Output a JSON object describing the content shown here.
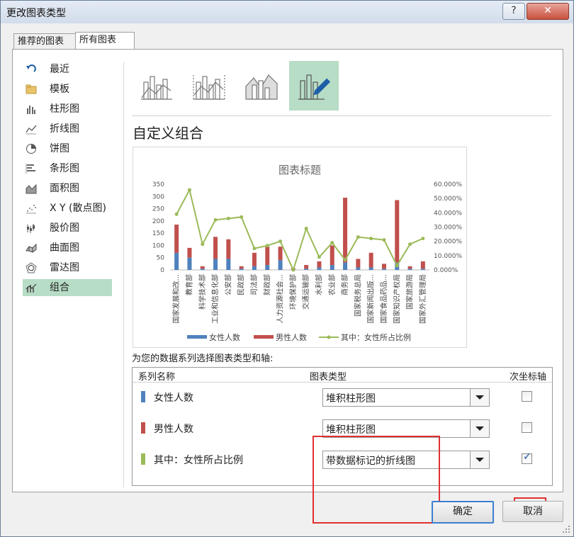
{
  "window": {
    "title": "更改图表类型",
    "help": "?",
    "close": "✕"
  },
  "tabs": [
    {
      "label": "推荐的图表"
    },
    {
      "label": "所有图表"
    }
  ],
  "sidebar": {
    "items": [
      {
        "label": "最近",
        "icon": "undo-icon"
      },
      {
        "label": "模板",
        "icon": "folder-icon"
      },
      {
        "label": "柱形图",
        "icon": "column-chart-icon"
      },
      {
        "label": "折线图",
        "icon": "line-chart-icon"
      },
      {
        "label": "饼图",
        "icon": "pie-chart-icon"
      },
      {
        "label": "条形图",
        "icon": "bar-chart-icon"
      },
      {
        "label": "面积图",
        "icon": "area-chart-icon"
      },
      {
        "label": "X Y (散点图)",
        "icon": "scatter-chart-icon"
      },
      {
        "label": "股价图",
        "icon": "stock-chart-icon"
      },
      {
        "label": "曲面图",
        "icon": "surface-chart-icon"
      },
      {
        "label": "雷达图",
        "icon": "radar-chart-icon"
      },
      {
        "label": "组合",
        "icon": "combo-chart-icon",
        "selected": true
      }
    ]
  },
  "thumbnails": [
    {
      "icon": "clustered-column-line-icon"
    },
    {
      "icon": "clustered-column-line-secondary-icon"
    },
    {
      "icon": "stacked-area-column-icon"
    },
    {
      "icon": "custom-combination-icon",
      "selected": true
    }
  ],
  "heading": "自定义组合",
  "chart_data": {
    "type": "bar",
    "title": "图表标题",
    "categories": [
      "国家发展和改...",
      "教育部",
      "科学技术部",
      "工业和信息化部",
      "公安部",
      "民政部",
      "司法部",
      "财政部",
      "人力资源社会...",
      "环境保护部",
      "交通运输部",
      "水利部",
      "农业部",
      "商务部",
      "国家税务总局",
      "国家新闻出版...",
      "国家食品药品...",
      "国家知识产权局",
      "国家旅游局",
      "国家外汇管理局"
    ],
    "series": [
      {
        "name": "女性人数",
        "chart": "stacked-bar",
        "axis": "primary",
        "color": "#4f81bd",
        "values": [
          70,
          50,
          5,
          45,
          45,
          5,
          15,
          20,
          40,
          2,
          5,
          10,
          20,
          30,
          10,
          10,
          5,
          30,
          5,
          5
        ]
      },
      {
        "name": "男性人数",
        "chart": "stacked-bar",
        "axis": "primary",
        "color": "#c0504d",
        "values": [
          115,
          40,
          10,
          90,
          80,
          10,
          55,
          75,
          55,
          5,
          15,
          25,
          80,
          265,
          35,
          60,
          20,
          255,
          10,
          30
        ]
      },
      {
        "name": "其中：女性所占比例",
        "chart": "line-markers",
        "axis": "secondary",
        "color": "#9bbb59",
        "values": [
          0.39,
          0.56,
          0.18,
          0.35,
          0.36,
          0.37,
          0.15,
          0.17,
          0.2,
          0.0,
          0.29,
          0.09,
          0.19,
          0.07,
          0.23,
          0.22,
          0.21,
          0.03,
          0.18,
          0.22
        ]
      }
    ],
    "yticks": [
      "350",
      "300",
      "250",
      "200",
      "150",
      "100",
      "50",
      "0"
    ],
    "y2ticks": [
      "60.000%",
      "50.000%",
      "40.000%",
      "30.000%",
      "20.000%",
      "10.000%",
      "0.000%"
    ],
    "ylim": [
      0,
      350
    ],
    "y2lim": [
      0,
      0.6
    ],
    "legend": "bottom",
    "grid": false
  },
  "series_prompt": "为您的数据系列选择图表类型和轴:",
  "grid": {
    "headers": {
      "name": "系列名称",
      "type": "图表类型",
      "axis": "次坐标轴"
    },
    "rows": [
      {
        "name": "女性人数",
        "type": "堆积柱形图",
        "color": "#4f81bd",
        "secondary": false
      },
      {
        "name": "男性人数",
        "type": "堆积柱形图",
        "color": "#c0504d",
        "secondary": false
      },
      {
        "name": "其中：女性所占比例",
        "type": "带数据标记的折线图",
        "color": "#9bbb59",
        "secondary": true
      }
    ]
  },
  "buttons": {
    "ok": "确定",
    "cancel": "取消"
  },
  "checkmark": "✓"
}
